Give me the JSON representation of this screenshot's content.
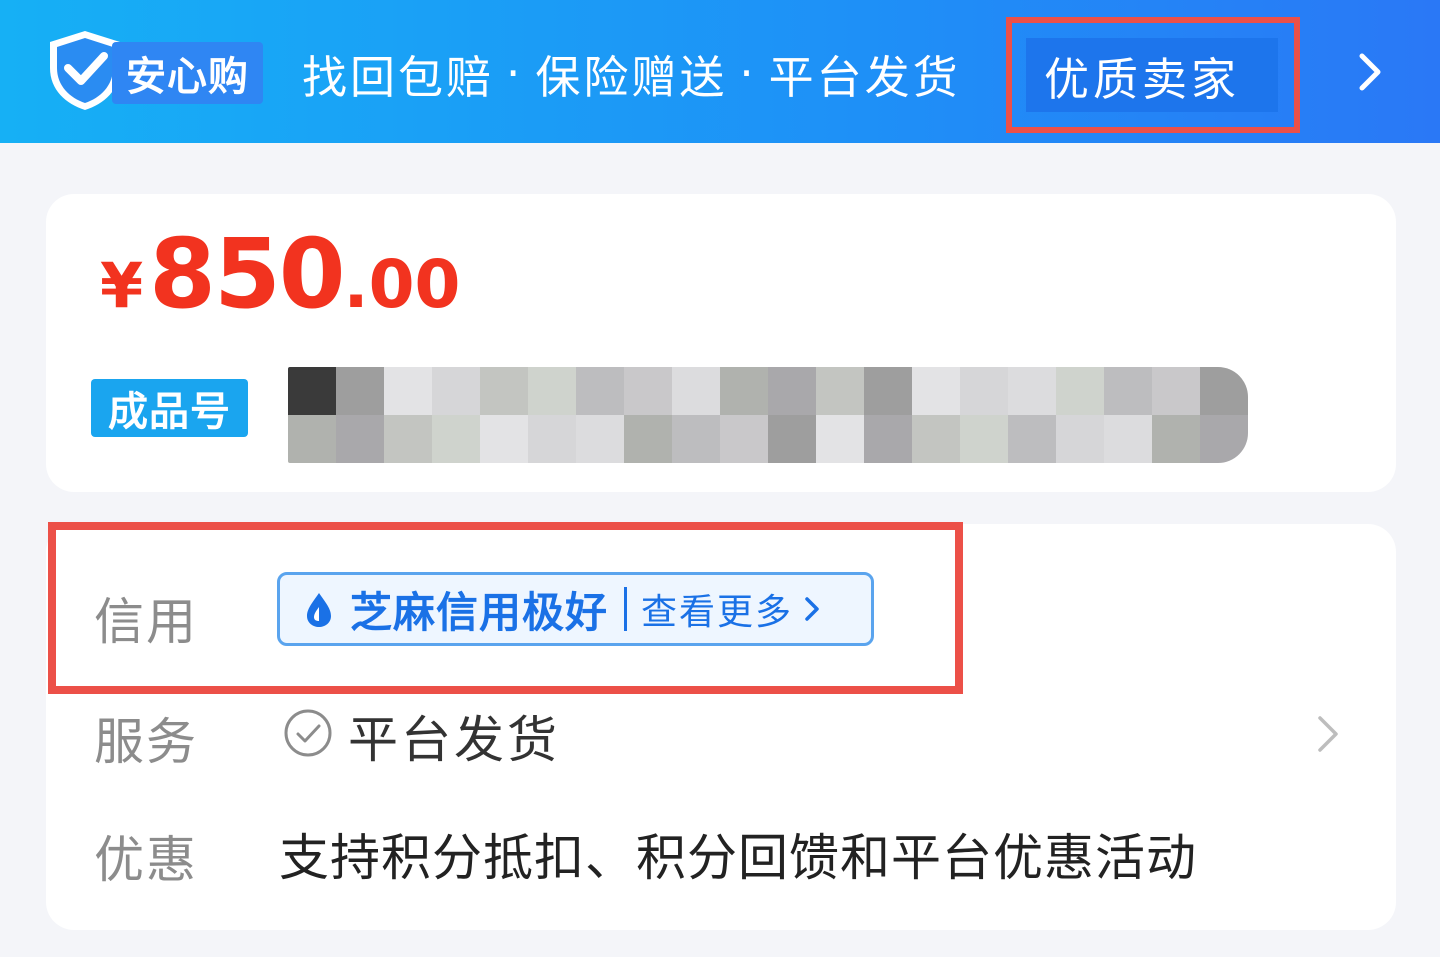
{
  "banner": {
    "brand_label": "安心购",
    "features": [
      "找回包赔",
      "保险赠送",
      "平台发货"
    ],
    "separator": "·",
    "highlight_label": "优质卖家",
    "colors": {
      "gradient_start": "#16b0f5",
      "gradient_end": "#2a78f6",
      "highlight_bg": "#1d75ec",
      "annotation": "#ec5048"
    }
  },
  "product": {
    "price": {
      "currency": "¥",
      "integer": "850",
      "decimal": ".00",
      "color": "#f2331f"
    },
    "type_tag": "成品号"
  },
  "details": {
    "credit": {
      "label": "信用",
      "rating": "芝麻信用极好",
      "more_label": "查看更多"
    },
    "service": {
      "label": "服务",
      "value": "平台发货"
    },
    "promotion": {
      "label": "优惠",
      "value": "支持积分抵扣、积分回馈和平台优惠活动"
    }
  },
  "icons": {
    "shield": "shield-check-icon",
    "banner_arrow": "chevron-right-icon",
    "drop": "sesame-drop-icon",
    "check": "check-circle-icon"
  }
}
